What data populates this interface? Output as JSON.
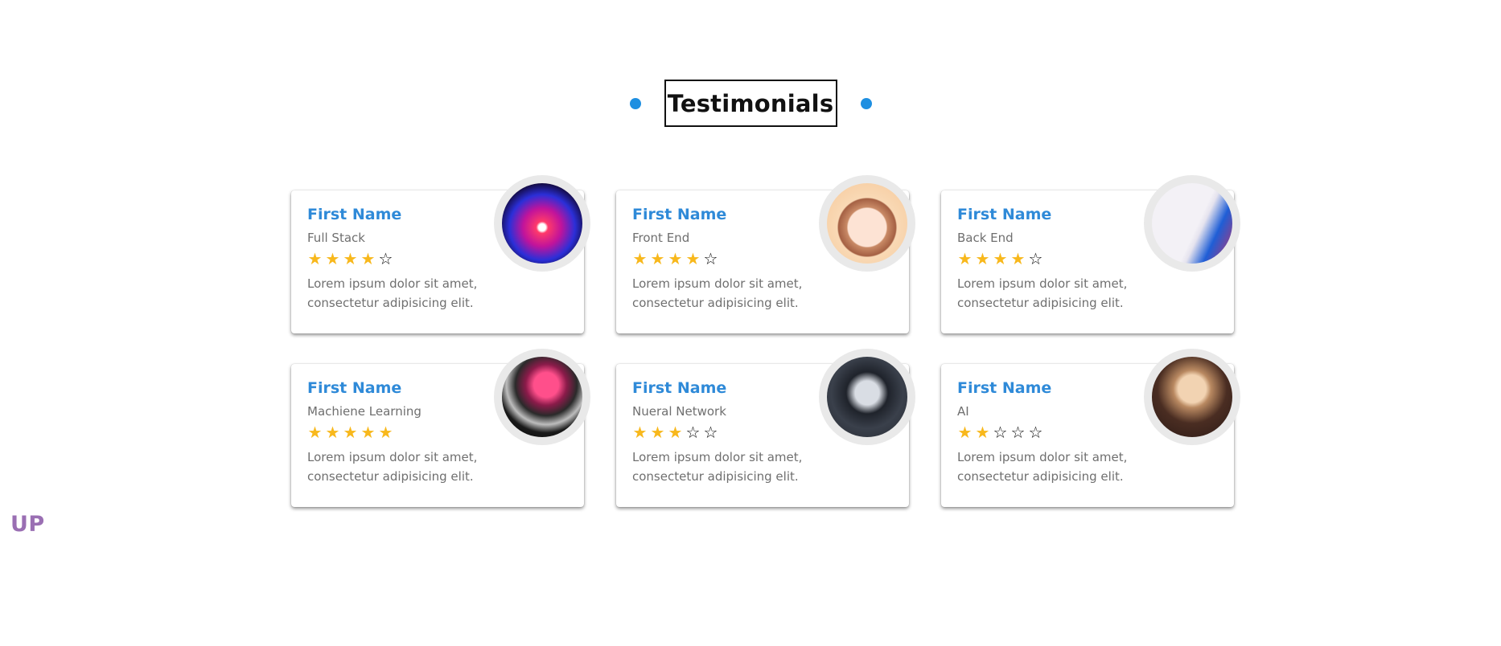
{
  "heading": {
    "title": "Testimonials",
    "accent_color": "#1e8fe1"
  },
  "cards": [
    {
      "name": "First Name",
      "role": "Full Stack",
      "rating": 4,
      "max_rating": 5,
      "text": "Lorem ipsum dolor sit amet, consectetur adipisicing elit.",
      "avatar_icon": "wolf-avatar"
    },
    {
      "name": "First Name",
      "role": "Front End",
      "rating": 4,
      "max_rating": 5,
      "text": "Lorem ipsum dolor sit amet, consectetur adipisicing elit.",
      "avatar_icon": "anime-girl-avatar"
    },
    {
      "name": "First Name",
      "role": "Back End",
      "rating": 4,
      "max_rating": 5,
      "text": "Lorem ipsum dolor sit amet, consectetur adipisicing elit.",
      "avatar_icon": "white-hair-girl-avatar"
    },
    {
      "name": "First Name",
      "role": "Machiene Learning",
      "rating": 5,
      "max_rating": 5,
      "text": "Lorem ipsum dolor sit amet, consectetur adipisicing elit.",
      "avatar_icon": "astronaut-avatar"
    },
    {
      "name": "First Name",
      "role": "Nueral Network",
      "rating": 3,
      "max_rating": 5,
      "text": "Lorem ipsum dolor sit amet, consectetur adipisicing elit.",
      "avatar_icon": "dark-hair-boy-avatar"
    },
    {
      "name": "First Name",
      "role": "AI",
      "rating": 2,
      "max_rating": 5,
      "text": "Lorem ipsum dolor sit amet, consectetur adipisicing elit.",
      "avatar_icon": "blond-boy-avatar"
    }
  ],
  "up_link": {
    "label": "UP"
  },
  "colors": {
    "name": "#2f8ad8",
    "star_filled": "#f8b81c",
    "star_empty": "#111111",
    "up_link": "#9a6fb3"
  }
}
